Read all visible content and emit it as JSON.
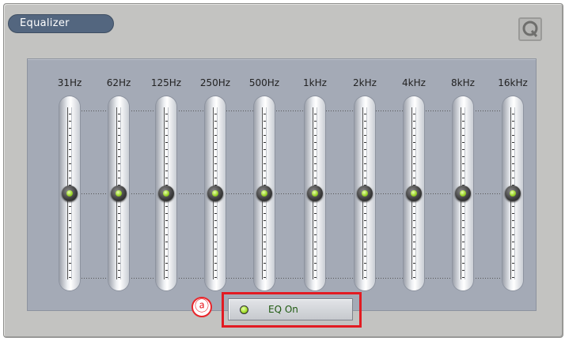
{
  "window": {
    "title": "Equalizer"
  },
  "bands": [
    "31Hz",
    "62Hz",
    "125Hz",
    "250Hz",
    "500Hz",
    "1kHz",
    "2kHz",
    "4kHz",
    "8kHz",
    "16kHz"
  ],
  "band_levels": [
    0.5,
    0.5,
    0.5,
    0.5,
    0.5,
    0.5,
    0.5,
    0.5,
    0.5,
    0.5
  ],
  "callout": {
    "marker": "ⓐ"
  },
  "eq_button": {
    "label": "EQ On",
    "state": "on"
  },
  "colors": {
    "accent": "#9bd42a",
    "title_pill": "#53667f",
    "callout": "#e21b22",
    "panel": "#a4aab6"
  }
}
